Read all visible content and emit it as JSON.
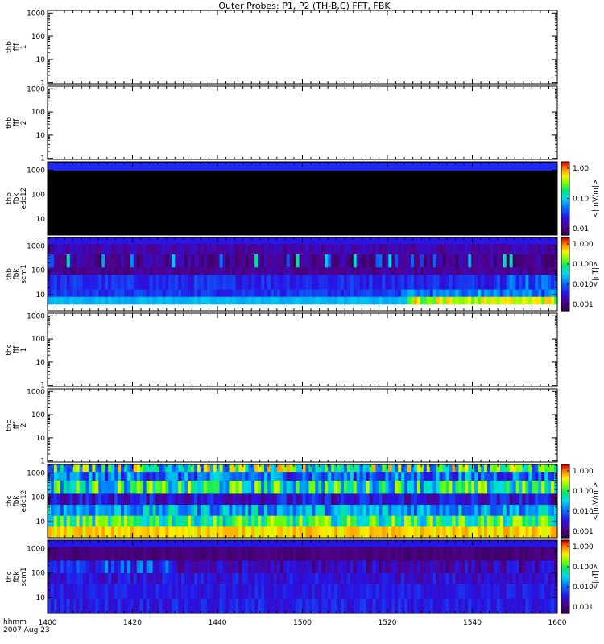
{
  "figure": {
    "title": "Outer Probes: P1, P2 (TH-B,C) FFT, FBK",
    "time_label": "hhmm",
    "date_label": "2007 Aug 23",
    "x_ticks": [
      "1400",
      "1420",
      "1440",
      "1500",
      "1520",
      "1540",
      "1600"
    ]
  },
  "chart_data": [
    {
      "type": "heatmap",
      "ylabel": [
        "thb",
        "fff",
        "1"
      ],
      "y_scale": "log",
      "ylim": [
        1,
        1000
      ],
      "y_ticks": [
        "1000",
        "100",
        "10",
        "1"
      ],
      "values": [],
      "colorbar": null,
      "pattern": "empty"
    },
    {
      "type": "heatmap",
      "ylabel": [
        "thb",
        "fff",
        "2"
      ],
      "y_scale": "log",
      "ylim": [
        1,
        1000
      ],
      "y_ticks": [
        "1000",
        "100",
        "10",
        "1"
      ],
      "values": [],
      "colorbar": null,
      "pattern": "empty"
    },
    {
      "type": "heatmap",
      "ylabel": [
        "thb",
        "fbk",
        "edc12"
      ],
      "y_scale": "log",
      "y_ticks": [
        "1000",
        "100",
        "10"
      ],
      "colorbar": {
        "label": "<|mV/m|>",
        "ticks": [
          "1.00",
          "0.10",
          "0.01"
        ],
        "scale": "log"
      },
      "pattern": "blacktop"
    },
    {
      "type": "heatmap",
      "ylabel": [
        "thb",
        "fbk",
        "scm1"
      ],
      "y_scale": "log",
      "y_ticks": [
        "1000",
        "100",
        "10"
      ],
      "colorbar": {
        "label": "<|nT|>",
        "ticks": [
          "1.000",
          "0.100",
          "0.010",
          "0.001"
        ],
        "scale": "log"
      },
      "pattern": "scm_b"
    },
    {
      "type": "heatmap",
      "ylabel": [
        "thc",
        "fff",
        "1"
      ],
      "y_scale": "log",
      "ylim": [
        1,
        1000
      ],
      "y_ticks": [
        "1000",
        "100",
        "10",
        "1"
      ],
      "values": [],
      "colorbar": null,
      "pattern": "empty"
    },
    {
      "type": "heatmap",
      "ylabel": [
        "thc",
        "fff",
        "2"
      ],
      "y_scale": "log",
      "ylim": [
        1,
        1000
      ],
      "y_ticks": [
        "1000",
        "100",
        "10",
        "1"
      ],
      "values": [],
      "colorbar": null,
      "pattern": "empty"
    },
    {
      "type": "heatmap",
      "ylabel": [
        "thc",
        "fbk",
        "edc12"
      ],
      "y_scale": "log",
      "y_ticks": [
        "1000",
        "100",
        "10"
      ],
      "colorbar": {
        "label": "<|mV/m|>",
        "ticks": [
          "1.000",
          "0.100",
          "0.010",
          "0.001"
        ],
        "scale": "log"
      },
      "pattern": "edc_c"
    },
    {
      "type": "heatmap",
      "ylabel": [
        "thc",
        "fbk",
        "scm1"
      ],
      "y_scale": "log",
      "y_ticks": [
        "1000",
        "100",
        "10"
      ],
      "colorbar": {
        "label": "<|nT|>",
        "ticks": [
          "1.000",
          "0.100",
          "0.010",
          "0.001"
        ],
        "scale": "log"
      },
      "pattern": "scm_c"
    }
  ]
}
